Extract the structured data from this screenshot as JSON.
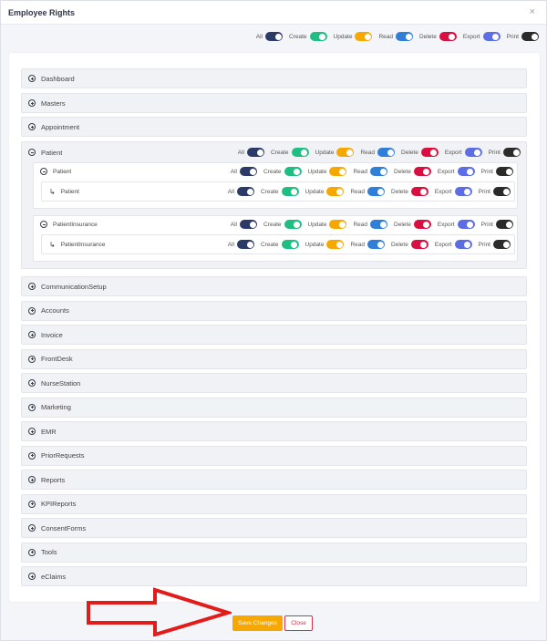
{
  "modal": {
    "title": "Employee Rights",
    "close_glyph": "×"
  },
  "permissions": [
    {
      "key": "all",
      "label": "All",
      "color": "#2b3a67"
    },
    {
      "key": "create",
      "label": "Create",
      "color": "#1fbf83"
    },
    {
      "key": "update",
      "label": "Update",
      "color": "#f7a800"
    },
    {
      "key": "read",
      "label": "Read",
      "color": "#2f7ed8"
    },
    {
      "key": "delete",
      "label": "Delete",
      "color": "#d90f3f"
    },
    {
      "key": "export",
      "label": "Export",
      "color": "#5b6ee6"
    },
    {
      "key": "print",
      "label": "Print",
      "color": "#2b2b2b"
    }
  ],
  "modules_before": [
    {
      "label": "Dashboard"
    },
    {
      "label": "Masters"
    },
    {
      "label": "Appointment"
    }
  ],
  "expanded": {
    "label": "Patient",
    "subs": [
      {
        "label": "Patient",
        "leaf_label": "Patient"
      },
      {
        "label": "PatientInsurance",
        "leaf_label": "PatientInsurance"
      }
    ]
  },
  "modules_after": [
    {
      "label": "CommunicationSetup"
    },
    {
      "label": "Accounts"
    },
    {
      "label": "Invoice"
    },
    {
      "label": "FrontDesk"
    },
    {
      "label": "NurseStation"
    },
    {
      "label": "Marketing"
    },
    {
      "label": "EMR"
    },
    {
      "label": "PriorRequests"
    },
    {
      "label": "Reports"
    },
    {
      "label": "KPIReports"
    },
    {
      "label": "ConsentForms"
    },
    {
      "label": "Tools"
    },
    {
      "label": "eClaims"
    }
  ],
  "footer": {
    "save_label": "Save Changes",
    "close_label": "Close"
  },
  "annotation": {
    "arrow_color": "#e21b1b"
  }
}
